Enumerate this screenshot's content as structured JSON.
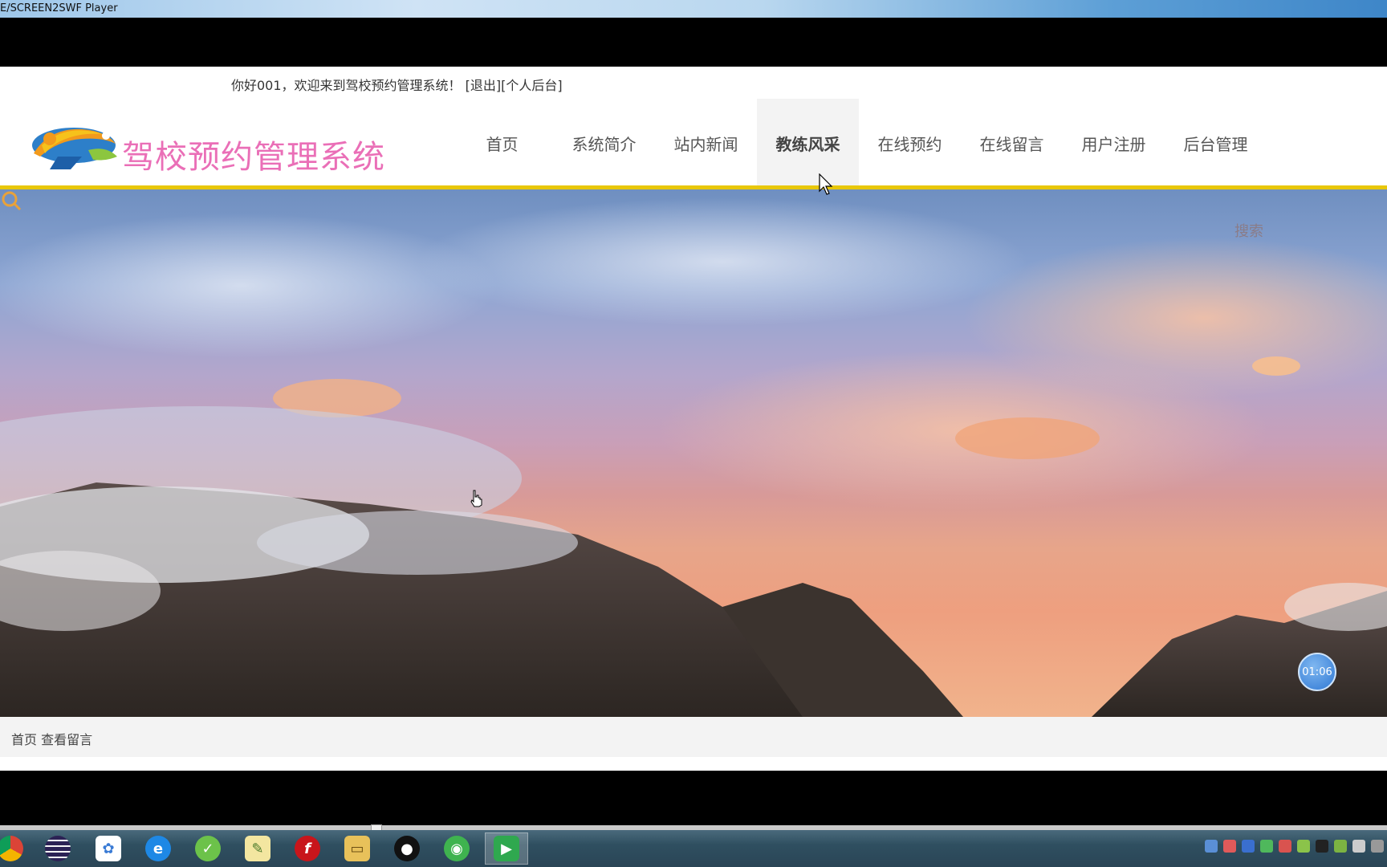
{
  "window": {
    "title": "E/SCREEN2SWF Player"
  },
  "page": {
    "welcome": {
      "greeting": "你好001，欢迎来到驾校预约管理系统！",
      "logout": "[退出]",
      "personal": "[个人后台]"
    },
    "site_title": "驾校预约管理系统",
    "nav": [
      {
        "label": "首页",
        "active": false
      },
      {
        "label": "系统简介",
        "active": false
      },
      {
        "label": "站内新闻",
        "active": false
      },
      {
        "label": "教练风采",
        "active": true
      },
      {
        "label": "在线预约",
        "active": false
      },
      {
        "label": "在线留言",
        "active": false
      },
      {
        "label": "用户注册",
        "active": false
      },
      {
        "label": "后台管理",
        "active": false
      }
    ],
    "banner": {
      "search_label": "搜索",
      "slides_total": 5,
      "slide_active": 1
    },
    "timer": "01:06",
    "breadcrumb": "首页 查看留言"
  },
  "colors": {
    "accent": "#e8c70a",
    "title": "#ea6fb7",
    "timer": "#2f78d4"
  },
  "taskbar": {
    "icons": [
      "chrome-icon",
      "eclipse-icon",
      "baidu-netdisk-icon",
      "browser-icon",
      "green-app-icon",
      "notepad-icon",
      "flash-icon",
      "file-explorer-icon",
      "qq-icon",
      "wechat-icon",
      "screen2swf-icon"
    ],
    "active": "screen2swf-icon"
  }
}
